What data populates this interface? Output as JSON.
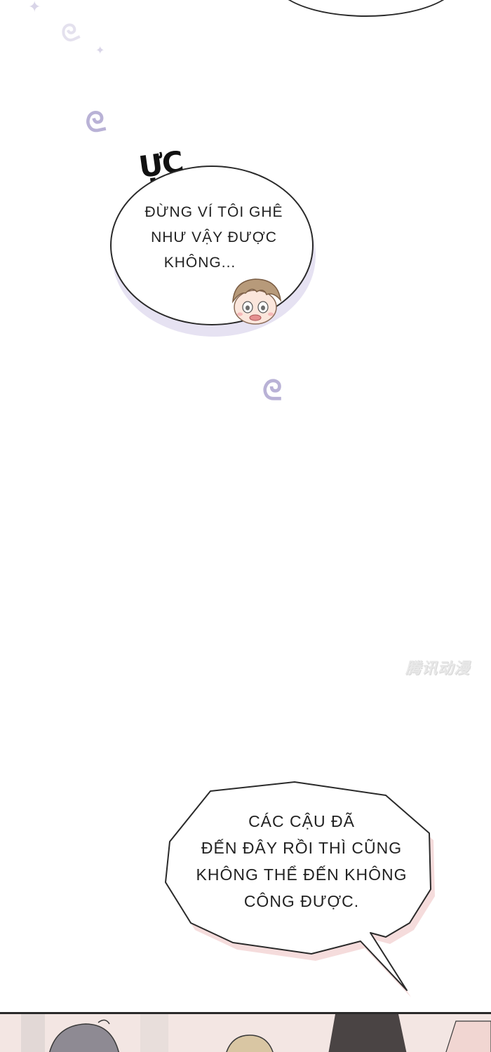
{
  "sfx": {
    "text": "ỰC"
  },
  "bubble_top": {
    "lines": [
      "ĐỪNG VÍ TÔI GHÊ",
      "NHƯ VẬY ĐƯỢC",
      "KHÔNG..."
    ]
  },
  "bubble_bottom": {
    "lines": [
      "CÁC CẬU ĐÃ",
      "ĐẾN ĐÂY RỒI THÌ CŨNG",
      "KHÔNG THỂ ĐẾN KHÔNG",
      "CÔNG ĐƯỢC."
    ]
  },
  "watermark": {
    "text": "腾讯动漫"
  },
  "colors": {
    "background": "#ffffff",
    "outline": "#2a2a2a",
    "lavender_accent": "#b9b2d6",
    "bubble_shadow_lavender": "#e6e2f2",
    "bubble_shadow_pink": "#f5dcdc",
    "bottom_panel": "#f3e6e3"
  },
  "icons": [
    "spiral-deco-icon",
    "sparkle-icon",
    "chibi-face-icon"
  ]
}
